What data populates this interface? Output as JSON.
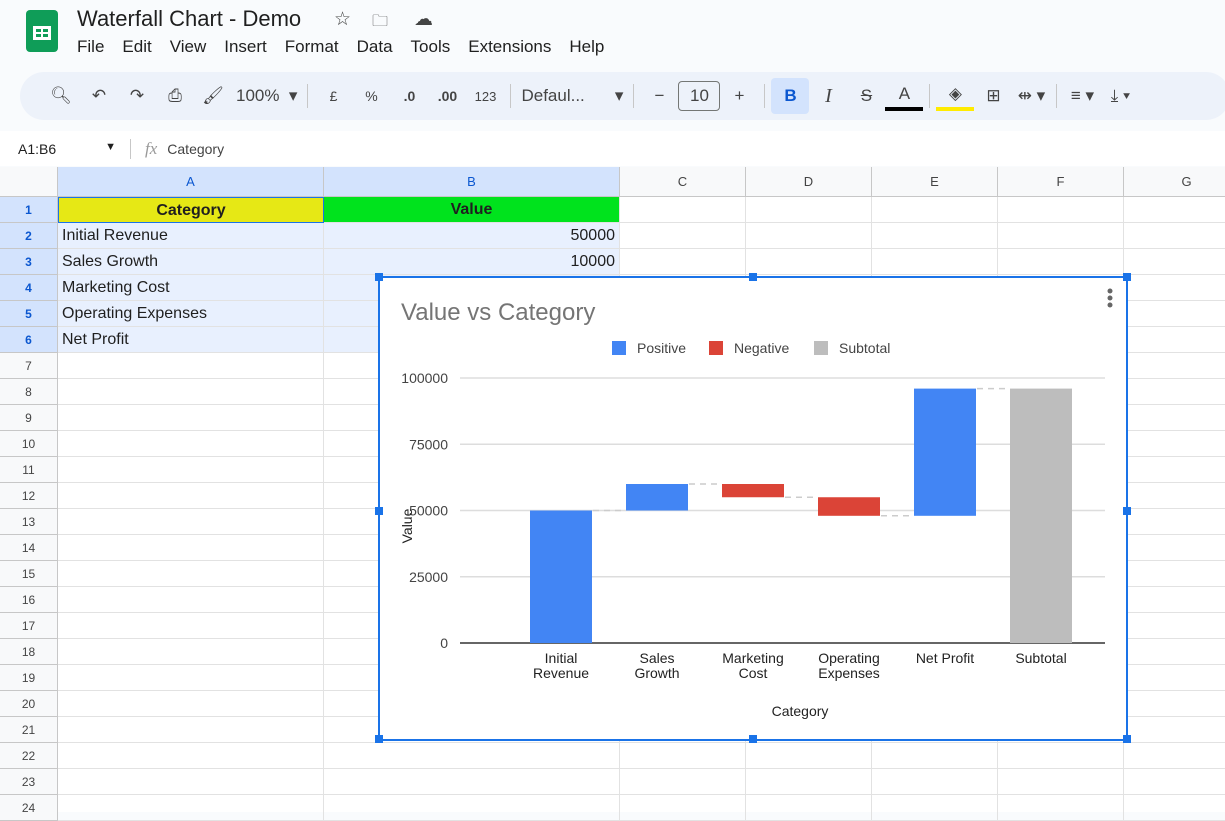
{
  "app": {
    "title": "Waterfall Chart - Demo",
    "menu": [
      "File",
      "Edit",
      "View",
      "Insert",
      "Format",
      "Data",
      "Tools",
      "Extensions",
      "Help"
    ]
  },
  "toolbar": {
    "zoom": "100%",
    "currency": "£",
    "percent": "%",
    "dec_decrease": ".0",
    "dec_increase": ".00",
    "number_format": "123",
    "font": "Defaul...",
    "font_size": "10",
    "bold": "B",
    "italic": "I",
    "strike": "S",
    "text_color": "A"
  },
  "formula_bar": {
    "name_box": "A1:B6",
    "fx": "fx",
    "content": "Category"
  },
  "columns": [
    "A",
    "B",
    "C",
    "D",
    "E",
    "F",
    "G"
  ],
  "rows": [
    "1",
    "2",
    "3",
    "4",
    "5",
    "6",
    "7",
    "8",
    "9",
    "10",
    "11",
    "12",
    "13",
    "14",
    "15",
    "16",
    "17",
    "18",
    "19",
    "20",
    "21",
    "22",
    "23",
    "24"
  ],
  "cells": {
    "A": [
      "Category",
      "Initial Revenue",
      "Sales Growth",
      "Marketing Cost",
      "Operating Expenses",
      "Net Profit"
    ],
    "B": [
      "Value",
      "50000",
      "10000"
    ]
  },
  "colors": {
    "header_a": "#e6e815",
    "header_b": "#00e31d",
    "positive": "#4285f4",
    "negative": "#db4437",
    "subtotal": "#bdbdbd"
  },
  "chart_data": {
    "type": "bar",
    "subtype": "waterfall",
    "title": "Value vs Category",
    "xlabel": "Category",
    "ylabel": "Value",
    "categories": [
      "Initial\nRevenue",
      "Sales\nGrowth",
      "Marketing\nCost",
      "Operating\nExpenses",
      "Net Profit",
      "Subtotal"
    ],
    "bars": [
      {
        "start": 0,
        "end": 50000,
        "kind": "positive"
      },
      {
        "start": 50000,
        "end": 60000,
        "kind": "positive"
      },
      {
        "start": 60000,
        "end": 55000,
        "kind": "negative"
      },
      {
        "start": 55000,
        "end": 48000,
        "kind": "negative"
      },
      {
        "start": 48000,
        "end": 96000,
        "kind": "positive"
      },
      {
        "start": 0,
        "end": 96000,
        "kind": "subtotal"
      }
    ],
    "legend": [
      {
        "label": "Positive",
        "kind": "positive"
      },
      {
        "label": "Negative",
        "kind": "negative"
      },
      {
        "label": "Subtotal",
        "kind": "subtotal"
      }
    ],
    "legend_position": "top",
    "yticks": [
      0,
      25000,
      50000,
      75000,
      100000
    ],
    "ylim": [
      0,
      100000
    ],
    "grid": true
  }
}
